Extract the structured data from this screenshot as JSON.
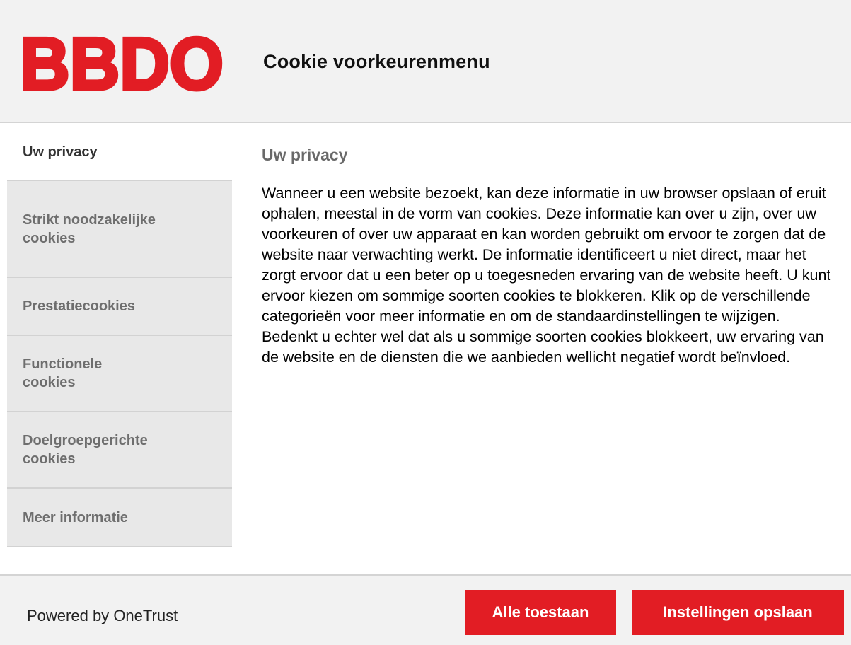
{
  "colors": {
    "brand": "#e21d24",
    "sidebar_bg": "#e8e8e8",
    "header_bg": "#f2f2f2"
  },
  "header": {
    "logo_text": "BBDO",
    "title": "Cookie voorkeurenmenu"
  },
  "sidebar": {
    "items": [
      {
        "label": "Uw privacy",
        "active": true
      },
      {
        "label": "Strikt noodzakelijke cookies",
        "active": false
      },
      {
        "label": "Prestatiecookies",
        "active": false
      },
      {
        "label": "Functionele cookies",
        "active": false
      },
      {
        "label": "Doelgroepgerichte cookies",
        "active": false
      },
      {
        "label": "Meer informatie",
        "active": false
      }
    ]
  },
  "content": {
    "title": "Uw privacy",
    "text": "Wanneer u een website bezoekt, kan deze informatie in uw browser opslaan of eruit ophalen, meestal in de vorm van cookies. Deze informatie kan over u zijn, over uw voorkeuren of over uw apparaat en kan worden gebruikt om ervoor te zorgen dat de website naar verwachting werkt. De informatie identificeert u niet direct, maar het zorgt ervoor dat u een beter op u toegesneden ervaring van de website heeft. U kunt ervoor kiezen om sommige soorten cookies te blokkeren. Klik op de verschillende categorieën voor meer informatie en om de standaardinstellingen te wijzigen. Bedenkt u echter wel dat als u sommige soorten cookies blokkeert, uw ervaring van de website en de diensten die we aanbieden wellicht negatief wordt beïnvloed."
  },
  "footer": {
    "powered_by": "Powered by",
    "powered_link": "OneTrust",
    "accept_all": "Alle toestaan",
    "save_settings": "Instellingen opslaan"
  }
}
